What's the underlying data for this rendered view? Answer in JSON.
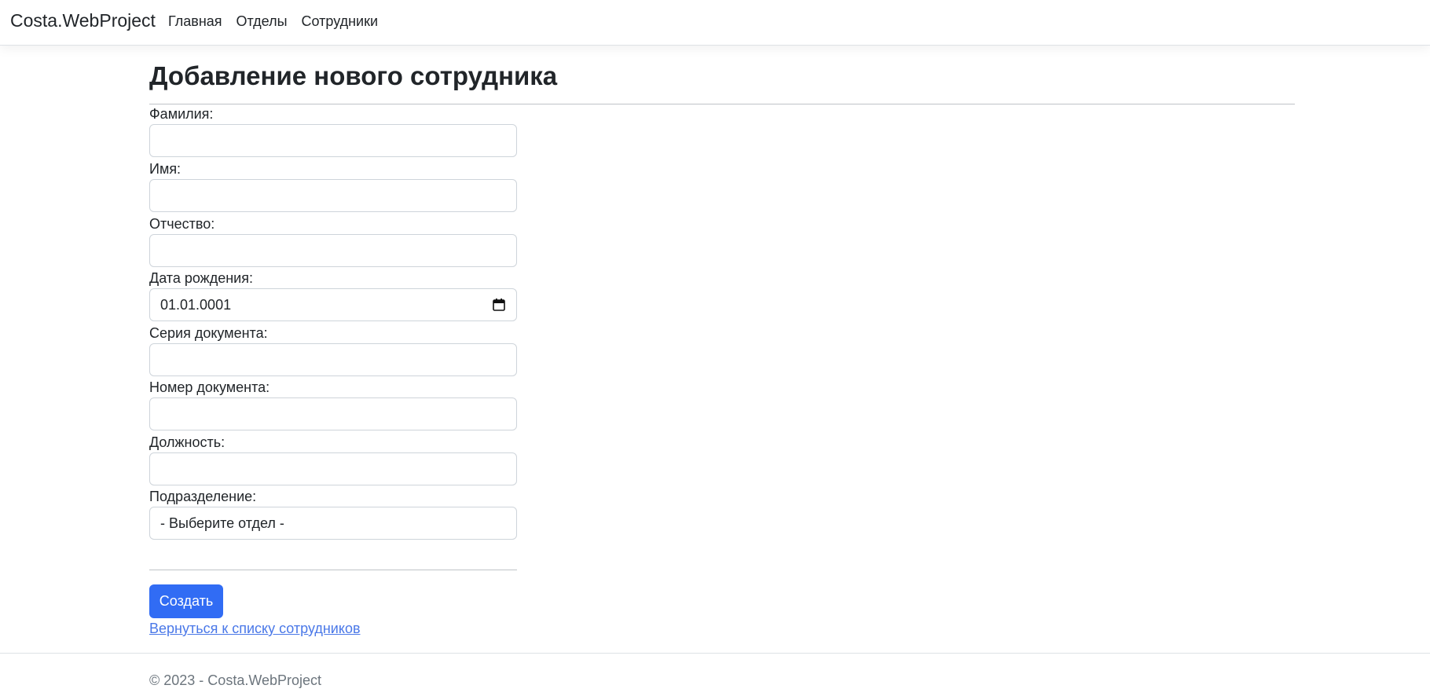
{
  "nav": {
    "brand": "Costa.WebProject",
    "links": [
      "Главная",
      "Отделы",
      "Сотрудники"
    ]
  },
  "page": {
    "title": "Добавление нового сотрудника"
  },
  "form": {
    "fields": [
      {
        "label": "Фамилия:",
        "value": ""
      },
      {
        "label": "Имя:",
        "value": ""
      },
      {
        "label": "Отчество:",
        "value": ""
      },
      {
        "label": "Дата рождения:",
        "value": "01.01.0001"
      },
      {
        "label": "Серия документа:",
        "value": ""
      },
      {
        "label": "Номер документа:",
        "value": ""
      },
      {
        "label": "Должность:",
        "value": ""
      },
      {
        "label": "Подразделение:",
        "value": "- Выберите отдел -"
      }
    ],
    "submit_label": "Создать",
    "back_link": "Вернуться к списку сотрудников"
  },
  "footer": {
    "text": "© 2023 - Costa.WebProject"
  },
  "colors": {
    "primary": "#316cf4",
    "link": "#4a78e8"
  }
}
